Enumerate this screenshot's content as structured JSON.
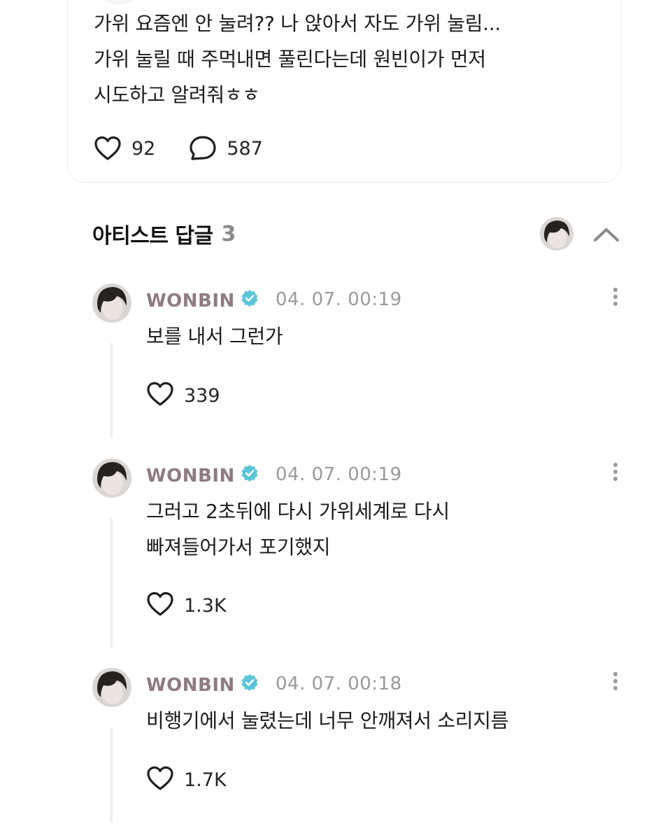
{
  "post": {
    "text": "가위 요즘엔 안 눌려?? 나 앉아서 자도 가위 눌림...\n가위 눌릴 때 주먹내면 풀린다는데 원빈이가 먼저\n시도하고 알려줘ㅎㅎ",
    "likes": "92",
    "comments": "587"
  },
  "artist_replies": {
    "title": "아티스트 답글",
    "count": "3"
  },
  "replies": [
    {
      "author": "WONBIN",
      "date": "04. 07. 00:19",
      "text": "보를 내서 그런가",
      "likes": "339"
    },
    {
      "author": "WONBIN",
      "date": "04. 07. 00:19",
      "text": "그러고 2초뒤에 다시 가위세계로 다시\n빠져들어가서 포기했지",
      "likes": "1.3K"
    },
    {
      "author": "WONBIN",
      "date": "04. 07. 00:18",
      "text": "비행기에서 눌렸는데 너무 안깨져서 소리지름",
      "likes": "1.7K"
    }
  ],
  "colors": {
    "author_name": "#8e7b80",
    "verified_badge": "#5bc4d8",
    "date": "#9a9a9a",
    "thread_line": "#ececec"
  },
  "icons": {
    "like": "heart-outline-icon",
    "comment": "speech-bubble-icon",
    "verified": "verified-badge-icon",
    "more": "more-vertical-icon",
    "collapse": "chevron-up-icon"
  }
}
